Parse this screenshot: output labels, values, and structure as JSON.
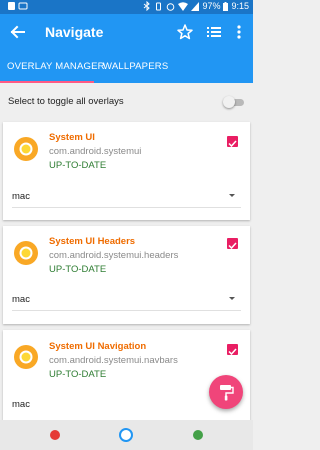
{
  "status_bar": {
    "time": "9:15",
    "battery": "97%"
  },
  "app_bar": {
    "title": "Navigate",
    "back_icon": "back-arrow-icon",
    "actions": [
      "star-icon",
      "list-icon",
      "more-vert-icon"
    ]
  },
  "tabs": [
    {
      "label": "OVERLAY MANAGER",
      "active": true
    },
    {
      "label": "WALLPAPERS",
      "active": false
    }
  ],
  "toggle_all": {
    "label": "Select to toggle all overlays",
    "enabled": false
  },
  "overlays": [
    {
      "name": "System UI",
      "package": "com.android.systemui",
      "status": "UP-TO-DATE",
      "variant": "mac",
      "checked": true
    },
    {
      "name": "System UI Headers",
      "package": "com.android.systemui.headers",
      "status": "UP-TO-DATE",
      "variant": "mac",
      "checked": true
    },
    {
      "name": "System UI Navigation",
      "package": "com.android.systemui.navbars",
      "status": "UP-TO-DATE",
      "variant": "mac",
      "checked": true
    }
  ],
  "colors": {
    "primary": "#2196f3",
    "accent": "#e91e63",
    "name_orange": "#ef6c00",
    "status_green": "#2e7d32"
  }
}
